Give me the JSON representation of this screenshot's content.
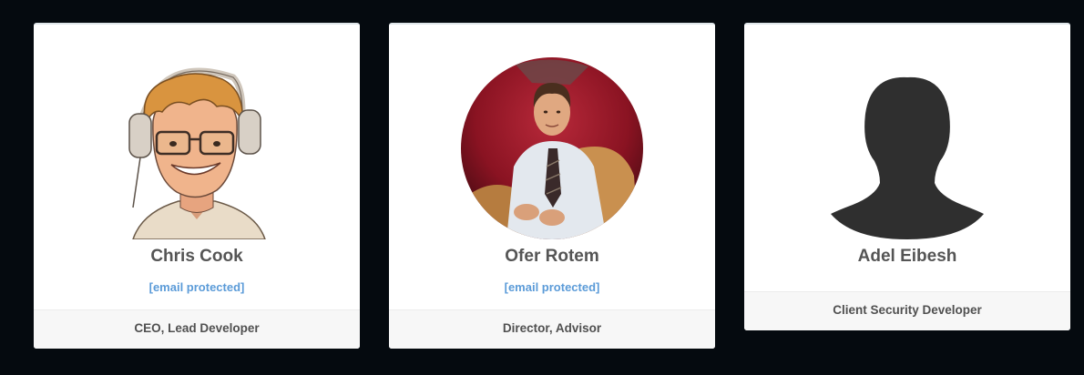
{
  "cards": [
    {
      "name": "Chris Cook",
      "email": "[email protected]",
      "role": "CEO, Lead Developer",
      "avatar": "cartoon-avatar"
    },
    {
      "name": "Ofer Rotem",
      "email": "[email protected]",
      "role": "Director, Advisor",
      "avatar": "photo-avatar"
    },
    {
      "name": "Adel Eibesh",
      "role": "Client Security Developer",
      "avatar": "silhouette-avatar"
    }
  ],
  "colors": {
    "page_background": "#050a0f",
    "card_background": "#ffffff",
    "name_text": "#555555",
    "email_link": "#5b9bd8",
    "footer_background": "#f7f7f7"
  }
}
